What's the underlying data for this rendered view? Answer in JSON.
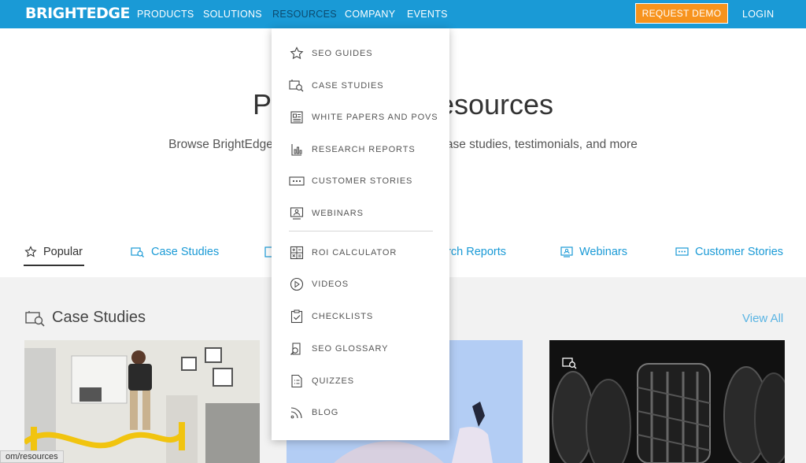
{
  "nav": {
    "logo": "BRIGHTEDGE",
    "items": [
      "PRODUCTS",
      "SOLUTIONS",
      "RESOURCES",
      "COMPANY",
      "EVENTS"
    ],
    "demo": "REQUEST DEMO",
    "login": "LOGIN"
  },
  "hero": {
    "title_start": "P",
    "title_end": "esources",
    "sub_start": "Browse BrightEdge",
    "sub_end": "ase studies, testimonials, and more"
  },
  "tabs": {
    "popular": "Popular",
    "case_studies": "Case Studies",
    "research_reports": "arch Reports",
    "webinars": "Webinars",
    "customer_stories": "Customer Stories"
  },
  "section": {
    "title": "Case Studies",
    "view_all": "View All"
  },
  "dropdown": {
    "items": [
      {
        "label": "SEO GUIDES",
        "icon": "star-icon"
      },
      {
        "label": "CASE STUDIES",
        "icon": "case-study-icon"
      },
      {
        "label": "WHITE PAPERS AND POVS",
        "icon": "document-icon"
      },
      {
        "label": "RESEARCH REPORTS",
        "icon": "report-chart-icon"
      },
      {
        "label": "CUSTOMER STORIES",
        "icon": "chat-dots-icon"
      },
      {
        "label": "WEBINARS",
        "icon": "webinar-icon"
      },
      {
        "label": "ROI CALCULATOR",
        "icon": "calculator-icon"
      },
      {
        "label": "VIDEOS",
        "icon": "play-icon"
      },
      {
        "label": "CHECKLISTS",
        "icon": "checklist-icon"
      },
      {
        "label": "SEO GLOSSARY",
        "icon": "glossary-search-icon"
      },
      {
        "label": "QUIZZES",
        "icon": "quiz-icon"
      },
      {
        "label": "BLOG",
        "icon": "rss-icon"
      }
    ]
  },
  "status_url": "om/resources",
  "colors": {
    "brand": "#1a9ad6",
    "accent": "#f7931d",
    "nav_active": "#0c4a6e"
  }
}
